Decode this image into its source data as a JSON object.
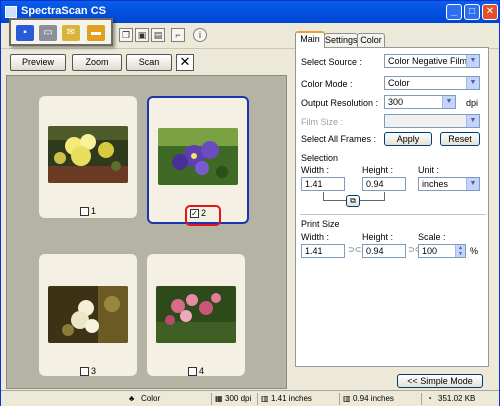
{
  "window": {
    "title": "SpectraScan CS"
  },
  "toolbar": {
    "icons": [
      "save-icon",
      "print-icon",
      "email-icon",
      "folder-icon",
      "copy-icon",
      "frame-icon",
      "page-icon",
      "crop-icon",
      "info-icon"
    ]
  },
  "commands": {
    "preview": "Preview",
    "zoom": "Zoom",
    "scan": "Scan",
    "clear": "✕"
  },
  "frames": [
    {
      "number": "1",
      "checked": false,
      "selected": false
    },
    {
      "number": "2",
      "checked": true,
      "selected": true
    },
    {
      "number": "3",
      "checked": false,
      "selected": false
    },
    {
      "number": "4",
      "checked": false,
      "selected": false
    }
  ],
  "tabs": [
    "Main",
    "Settings",
    "Color"
  ],
  "main": {
    "select_source_label": "Select Source :",
    "select_source_value": "Color Negative Film",
    "color_mode_label": "Color Mode :",
    "color_mode_value": "Color",
    "output_resolution_label": "Output Resolution :",
    "output_resolution_value": "300",
    "resolution_unit": "dpi",
    "film_size_label": "Film Size :",
    "select_all_label": "Select All Frames :",
    "apply": "Apply",
    "reset": "Reset",
    "selection_heading": "Selection",
    "width_label": "Width :",
    "height_label": "Height :",
    "unit_label": "Unit :",
    "selection_width": "1.41",
    "selection_height": "0.94",
    "unit_value": "inches",
    "print_size_heading": "Print Size",
    "print_width_label": "Width :",
    "print_height_label": "Height :",
    "scale_label": "Scale :",
    "print_width": "1.41",
    "print_height": "0.94",
    "scale_value": "100",
    "scale_unit": "%"
  },
  "simple_mode": "<< Simple Mode",
  "status": {
    "color": "Color",
    "resolution": "300 dpi",
    "width": "1.41 inches",
    "height": "0.94 inches",
    "size": "351.02 KB"
  }
}
